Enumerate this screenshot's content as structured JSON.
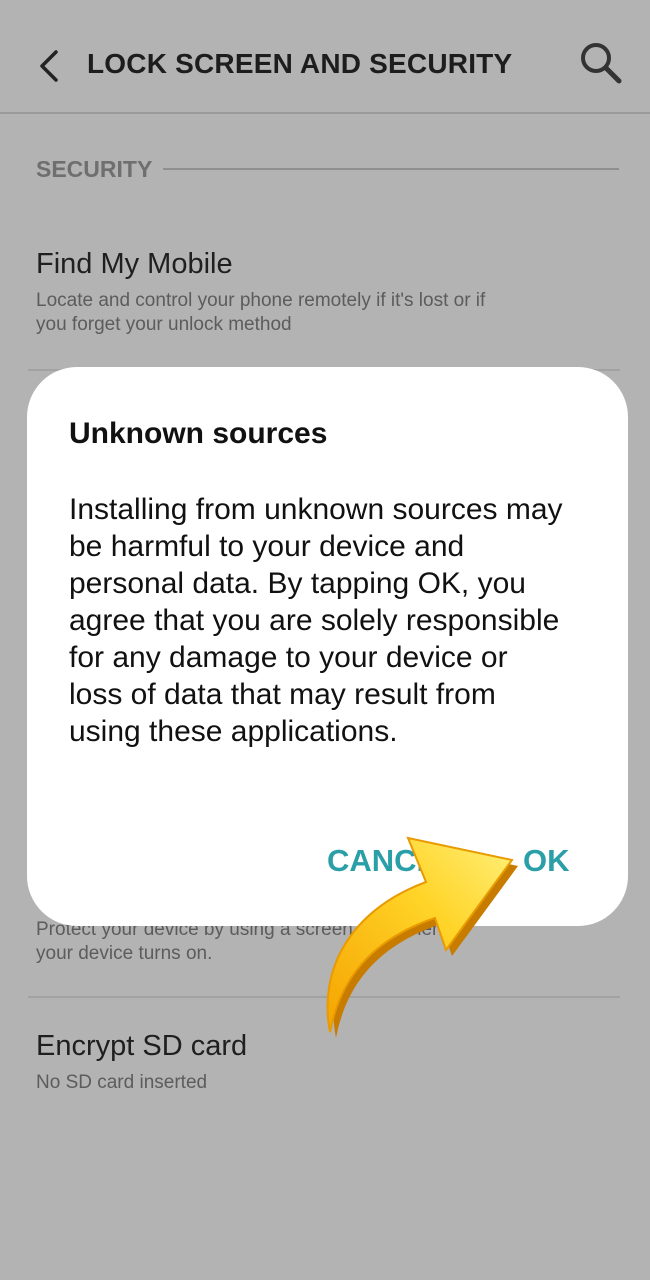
{
  "header": {
    "title": "LOCK SCREEN AND SECURITY",
    "back_icon": "back-arrow-icon",
    "search_icon": "search-icon"
  },
  "section": {
    "label": "SECURITY"
  },
  "items": [
    {
      "title": "Find My Mobile",
      "subtitle": "Locate and control your phone remotely if it's lost or if you forget your unlock method"
    },
    {
      "title": "",
      "subtitle": "Protect your device by using a screen lock when your device turns on."
    },
    {
      "title": "Encrypt SD card",
      "subtitle": "No SD card inserted"
    }
  ],
  "dialog": {
    "title": "Unknown sources",
    "message": "Installing from unknown sources may be harmful to your device and personal data. By tapping OK, you agree that you are solely responsible for any damage to your device or loss of data that may result from using these applications.",
    "cancel_label": "CANCEL",
    "ok_label": "OK"
  },
  "colors": {
    "dim_background": "#b3b3b3",
    "accent": "#2b9fa8",
    "arrow_fill": "#f7c21a"
  }
}
